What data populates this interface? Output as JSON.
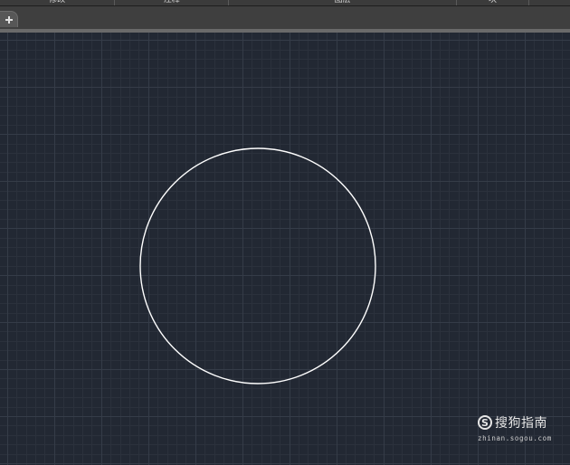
{
  "ribbon": {
    "panels": [
      {
        "label": "修改"
      },
      {
        "label": "注释"
      },
      {
        "label": "图层"
      },
      {
        "label": "块"
      },
      {
        "label": ""
      }
    ]
  },
  "tabs": {
    "new_tab_icon": "plus-icon"
  },
  "canvas": {
    "background_color": "#222833",
    "grid_minor_color": "#2b313c",
    "grid_major_color": "#353c48",
    "grid": true,
    "shape": {
      "type": "circle",
      "stroke_color": "#ffffff"
    }
  },
  "watermark": {
    "logo_letter": "S",
    "brand": "搜狗指南",
    "url": "zhinan.sogou.com"
  }
}
